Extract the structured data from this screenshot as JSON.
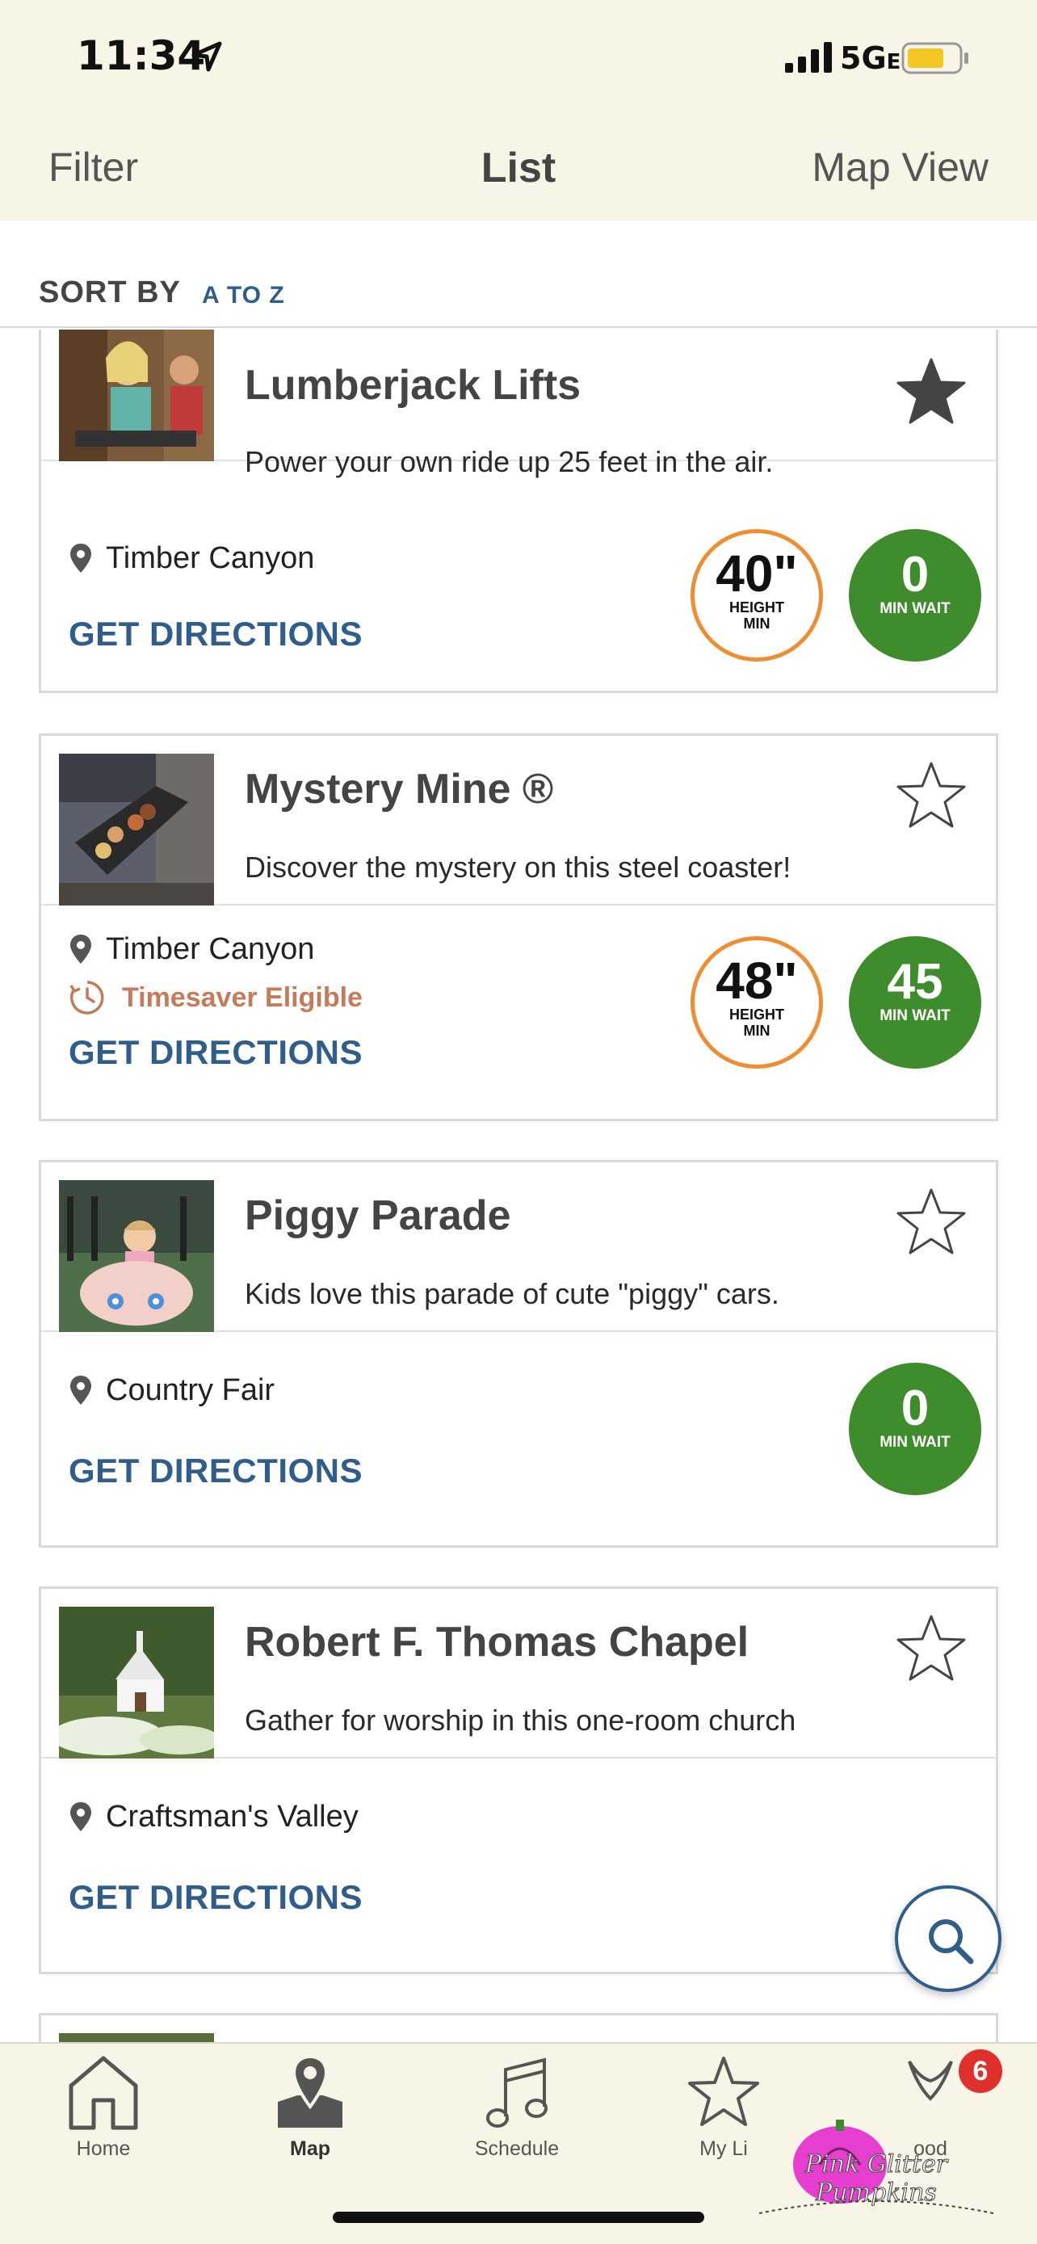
{
  "status_bar": {
    "time": "11:34",
    "network": "5G",
    "network_suffix": "E"
  },
  "header": {
    "filter_label": "Filter",
    "title": "List",
    "map_view_label": "Map View"
  },
  "sort": {
    "label": "SORT BY",
    "value": "A TO Z"
  },
  "attractions": [
    {
      "title": "Lumberjack Lifts",
      "description": "Power your own ride up 25 feet in the air.",
      "location": "Timber Canyon",
      "directions_label": "GET DIRECTIONS",
      "favorited": true,
      "height": "40\"",
      "height_label_1": "HEIGHT",
      "height_label_2": "MIN",
      "wait": "0",
      "wait_label": "MIN WAIT"
    },
    {
      "title": "Mystery Mine ®",
      "description": "Discover the mystery on this steel coaster!",
      "location": "Timber Canyon",
      "timesaver": "Timesaver Eligible",
      "directions_label": "GET DIRECTIONS",
      "favorited": false,
      "height": "48\"",
      "height_label_1": "HEIGHT",
      "height_label_2": "MIN",
      "wait": "45",
      "wait_label": "MIN WAIT"
    },
    {
      "title": "Piggy Parade",
      "description": "Kids love this parade of cute \"piggy\" cars.",
      "location": "Country Fair",
      "directions_label": "GET DIRECTIONS",
      "favorited": false,
      "wait": "0",
      "wait_label": "MIN WAIT"
    },
    {
      "title": "Robert F. Thomas Chapel",
      "description": "Gather for worship in this one-room church",
      "location": "Craftsman's Valley",
      "directions_label": "GET DIRECTIONS",
      "favorited": false
    }
  ],
  "tabs": [
    {
      "label": "Home",
      "icon": "home-icon",
      "active": false
    },
    {
      "label": "Map",
      "icon": "map-pin-icon",
      "active": true
    },
    {
      "label": "Schedule",
      "icon": "music-note-icon",
      "active": false
    },
    {
      "label": "My Li",
      "icon": "star-icon",
      "active": false
    },
    {
      "label": "ood",
      "icon": "hood-icon",
      "active": false
    }
  ],
  "tab_badge": "6",
  "watermark_text": "Pink Glitter Pumpkins",
  "colors": {
    "header_bg": "#f8f5e6",
    "link_blue": "#2f5d8c",
    "height_orange": "#ef8d33",
    "wait_green": "#3e8c2b",
    "timesaver": "#c57a5a",
    "badge_red": "#e0302b"
  }
}
